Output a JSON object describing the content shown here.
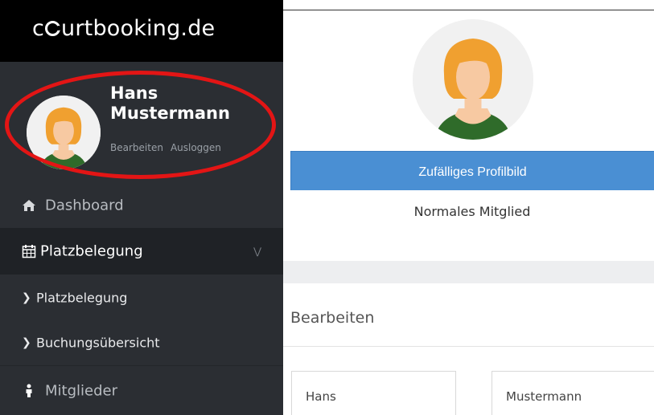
{
  "brand": {
    "prefix": "c",
    "suffix": "urtbooking.de"
  },
  "user": {
    "name": "Hans Mustermann",
    "edit_link": "Bearbeiten",
    "logout_link": "Ausloggen"
  },
  "nav": {
    "dashboard": {
      "label": "Dashboard",
      "icon": "home-icon"
    },
    "platzbelegung": {
      "label": "Platzbelegung",
      "icon": "calendar-icon",
      "expanded": true
    },
    "sub_platzbelegung": {
      "label": "Platzbelegung"
    },
    "sub_buchung": {
      "label": "Buchungsübersicht"
    },
    "mitglieder": {
      "label": "Mitglieder",
      "icon": "user-icon"
    }
  },
  "profile": {
    "random_button_label": "Zufälliges Profilbild",
    "member_type": "Normales Mitglied"
  },
  "edit": {
    "title": "Bearbeiten",
    "first_name": "Hans",
    "last_name": "Mustermann"
  },
  "colors": {
    "sidebar": "#2b2e33",
    "active_nav": "#1f2226",
    "button": "#4a8fd3",
    "highlight": "#e31515",
    "hair": "#f0a030",
    "skin": "#f7c9a2",
    "shirt": "#2f6b2a"
  }
}
